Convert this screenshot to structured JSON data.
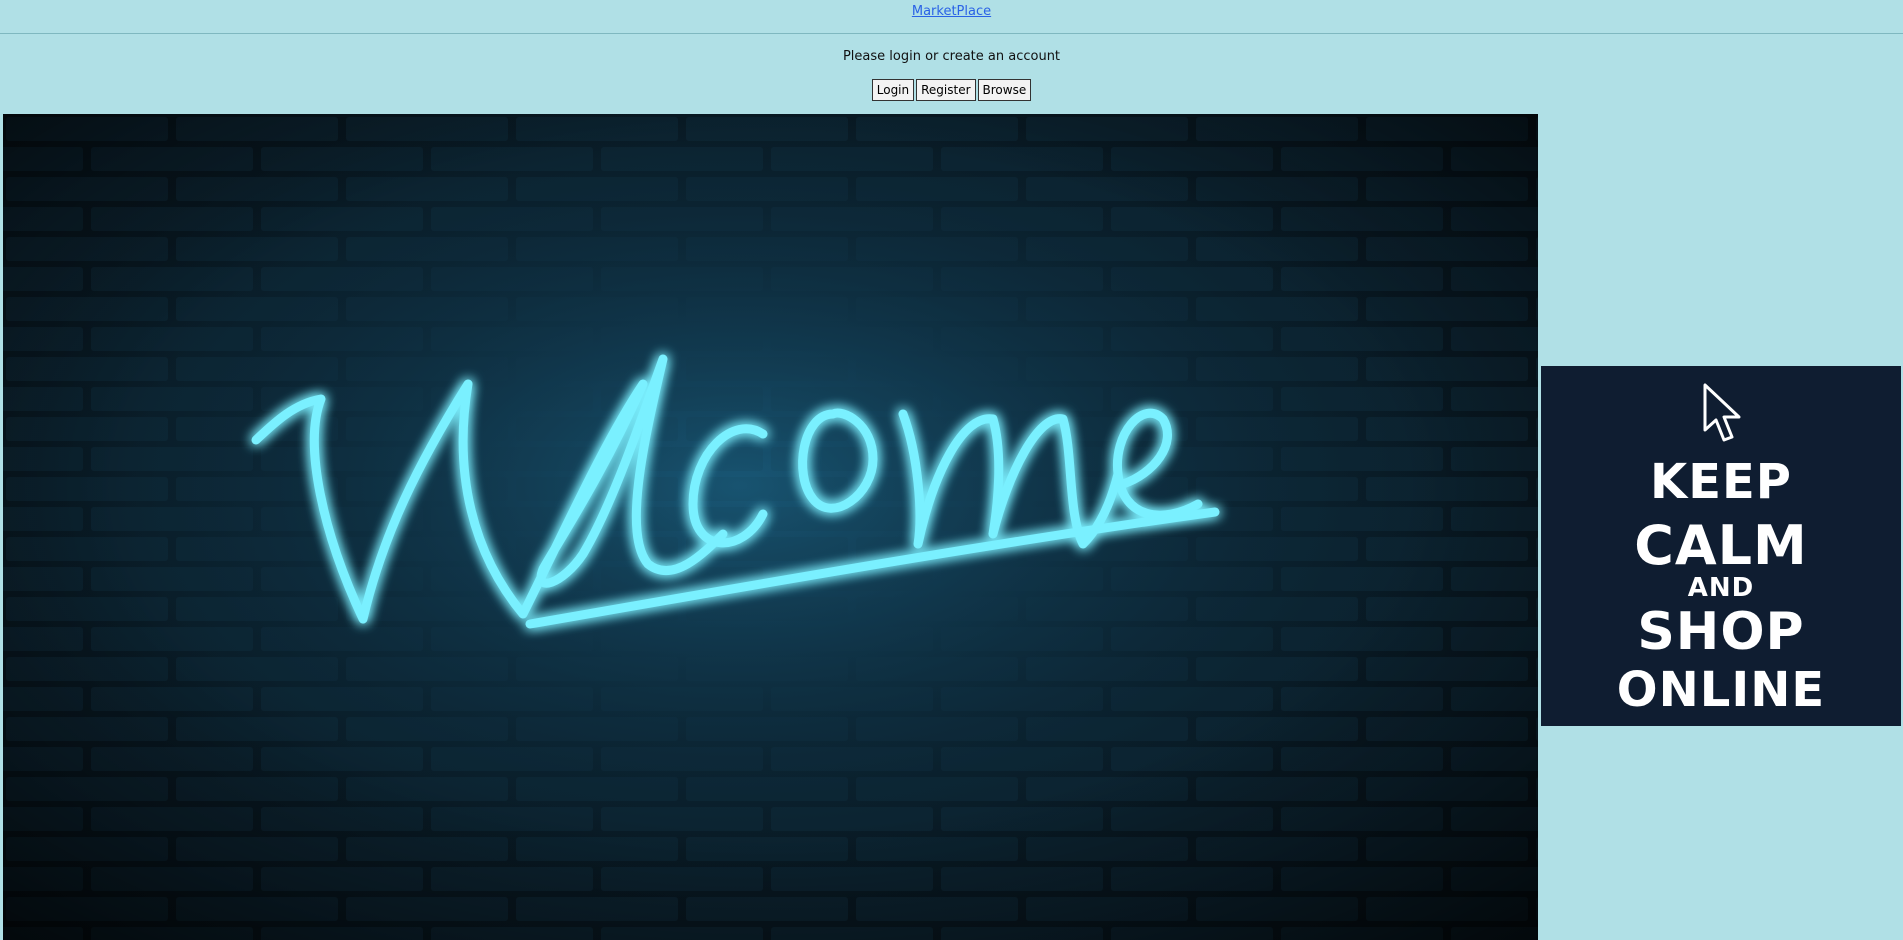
{
  "header": {
    "brand_link": "MarketPlace"
  },
  "auth": {
    "prompt": "Please login or create an account",
    "login_label": "Login",
    "register_label": "Register",
    "browse_label": "Browse"
  },
  "hero": {
    "neon_text": "Welcome",
    "colors": {
      "neon": "#4fe3ff",
      "wall": "#0c2533"
    }
  },
  "promo": {
    "lines": [
      "KEEP",
      "CALM",
      "AND",
      "SHOP",
      "ONLINE"
    ],
    "icon": "mouse-pointer-icon",
    "colors": {
      "background": "#0f1d31",
      "text": "#ffffff"
    }
  },
  "colors": {
    "page_background": "#b0e0e6",
    "link": "#2a62e6"
  }
}
